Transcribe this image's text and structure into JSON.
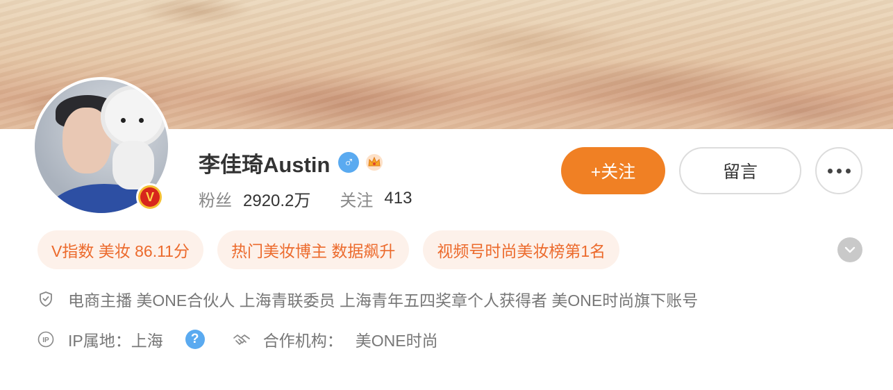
{
  "profile": {
    "name": "李佳琦Austin",
    "gender_icon": "male-icon",
    "stats": {
      "fans_label": "粉丝",
      "fans_value": "2920.2万",
      "following_label": "关注",
      "following_value": "413"
    }
  },
  "actions": {
    "follow_label": "+关注",
    "message_label": "留言"
  },
  "tags": [
    "V指数 美妆 86.11分",
    "热门美妆博主 数据飙升",
    "视频号时尚美妆榜第1名"
  ],
  "info": {
    "verification": "电商主播 美ONE合伙人 上海青联委员 上海青年五四奖章个人获得者 美ONE时尚旗下账号",
    "ip_label": "IP属地：上海",
    "org_label": "合作机构：",
    "org_value": "美ONE时尚"
  },
  "colors": {
    "accent": "#f08024",
    "tag_bg": "#fdf1ea",
    "tag_text": "#ec6a2c",
    "blue": "#5aaaf0"
  }
}
